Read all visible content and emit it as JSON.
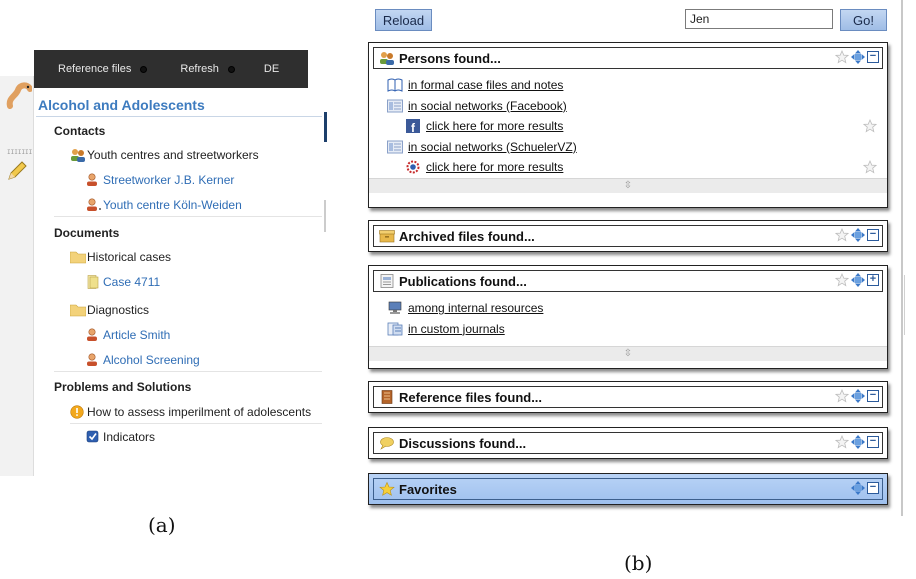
{
  "panel_a": {
    "topbar": [
      "Reference files",
      "Refresh",
      "DE"
    ],
    "title": "Alcohol and Adolescents",
    "tree": [
      {
        "type": "header",
        "label": "Contacts"
      },
      {
        "type": "group",
        "icon": "persons-icon",
        "label": "Youth centres and streetworkers"
      },
      {
        "type": "leaf",
        "icon": "person-icon",
        "label": "Streetworker J.B. Kerner"
      },
      {
        "type": "leaf",
        "icon": "person-icon",
        "label": "Youth centre Köln-Weiden"
      },
      {
        "type": "header",
        "label": "Documents"
      },
      {
        "type": "group",
        "icon": "folder-icon",
        "label": "Historical cases"
      },
      {
        "type": "leaf",
        "icon": "document-icon",
        "label": "Case 4711"
      },
      {
        "type": "group",
        "icon": "folder-icon",
        "label": "Diagnostics"
      },
      {
        "type": "leaf",
        "icon": "person-icon",
        "label": "Article Smith"
      },
      {
        "type": "leaf",
        "icon": "person-icon",
        "label": "Alcohol Screening"
      },
      {
        "type": "header",
        "label": "Problems and Solutions"
      },
      {
        "type": "group",
        "icon": "warning-icon",
        "label": "How to assess imperilment of adolescents"
      },
      {
        "type": "leaf",
        "icon": "checkbox-icon",
        "label": "Indicators"
      }
    ],
    "caption": "(a)"
  },
  "panel_b": {
    "reload_label": "Reload",
    "search_value": "Jen",
    "go_label": "Go!",
    "boxes": {
      "persons": {
        "title": "Persons found...",
        "items": [
          "in formal case files and notes",
          "in social networks (Facebook)",
          "click here for more results",
          "in social networks (SchuelerVZ)",
          "click here for more results"
        ]
      },
      "archived": {
        "title": "Archived files found..."
      },
      "publications": {
        "title": "Publications found...",
        "items": [
          "among internal resources",
          "in custom journals"
        ]
      },
      "reference": {
        "title": "Reference files found..."
      },
      "discussions": {
        "title": "Discussions found..."
      },
      "favorites": {
        "title": "Favorites"
      }
    },
    "caption": "(b)"
  },
  "colors": {
    "link_blue": "#2f6db5",
    "topbar": "#2f2f2f",
    "button_blue": "#b3cdee",
    "favorites_bg": "#a9c8f2"
  }
}
